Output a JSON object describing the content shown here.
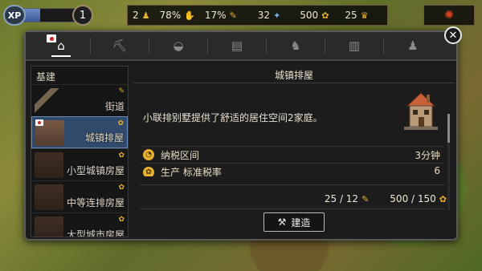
{
  "topbar": {
    "xp_label": "XP",
    "xp_progress": 0.35,
    "level": "1",
    "resources": [
      {
        "icon": "worker-icon",
        "value": "2"
      },
      {
        "icon": "happiness-icon",
        "value": "78%"
      },
      {
        "icon": "tax-icon",
        "value": "17%"
      },
      {
        "icon": "wood-icon",
        "value": "32"
      },
      {
        "icon": "coins-icon",
        "value": "500"
      },
      {
        "icon": "crown-icon",
        "value": "25"
      }
    ]
  },
  "tabs": [
    {
      "name": "tab-home",
      "glyph": "⌂"
    },
    {
      "name": "tab-mining",
      "glyph": "⛏"
    },
    {
      "name": "tab-food",
      "glyph": "◈"
    },
    {
      "name": "tab-industry",
      "glyph": "▤"
    },
    {
      "name": "tab-entertainment",
      "glyph": "♞"
    },
    {
      "name": "tab-civic",
      "glyph": "▥"
    },
    {
      "name": "tab-decor",
      "glyph": "♟"
    }
  ],
  "left_panel": {
    "header": "基建",
    "items": [
      "街道",
      "城镇排屋",
      "小型城镇房屋",
      "中等连排房屋",
      "大型城市房屋"
    ]
  },
  "detail": {
    "title": "城镇排屋",
    "description": "小联排别墅提供了舒适的居住空间2家庭。",
    "stats": [
      {
        "label": "纳税区间",
        "value": "3分钟"
      },
      {
        "label": "生产 标准税率",
        "value": "6"
      }
    ],
    "cost_workers": "25 / 12",
    "cost_coins": "500 / 150",
    "build_label": "建造"
  }
}
